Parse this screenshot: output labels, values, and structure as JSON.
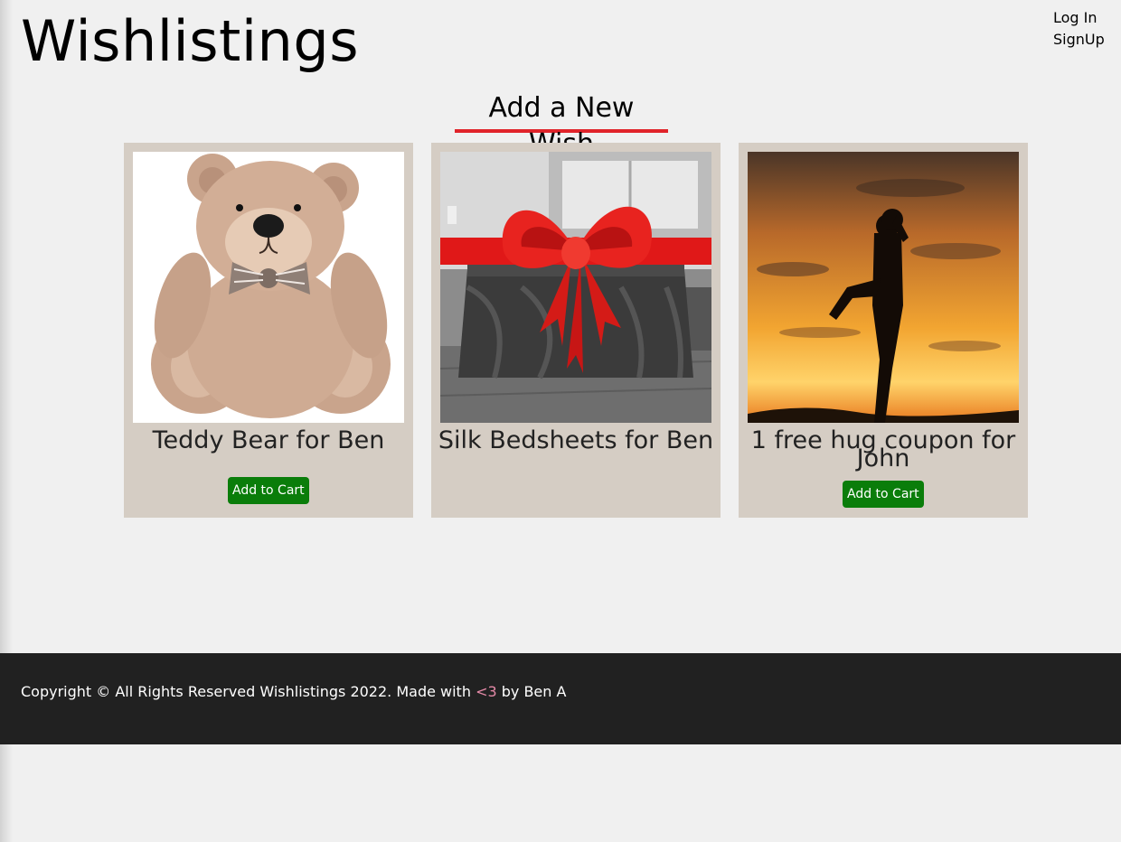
{
  "header": {
    "site_title": "Wishlistings",
    "login_link": "Log In",
    "signup_link": "SignUp"
  },
  "main": {
    "add_wish_label": "Add a New Wish",
    "cards": [
      {
        "name_line1": "Teddy Bear for Ben",
        "name_line2": "",
        "image": "teddy-bear-photo",
        "button": "Add to Cart"
      },
      {
        "name_line1": "Silk Bedsheets for Ben",
        "name_line2": "",
        "image": "bedsheets-with-red-bow-photo",
        "button": ""
      },
      {
        "name_line1": "1 free hug coupon for",
        "name_line2": "John",
        "image": "sunset-hug-silhouette-photo",
        "button": "Add to Cart"
      }
    ]
  },
  "footer": {
    "text_before": "Copyright © All Rights Reserved Wishlistings 2022. Made with ",
    "heart": "<3",
    "text_after": " by Ben A"
  },
  "colors": {
    "background": "#f0f0f0",
    "card_background": "#d5cdc4",
    "add_wish_underline": "#e0232a",
    "cart_button": "#0a7d0a",
    "footer_background": "#212121",
    "heart": "#e58aa8"
  }
}
